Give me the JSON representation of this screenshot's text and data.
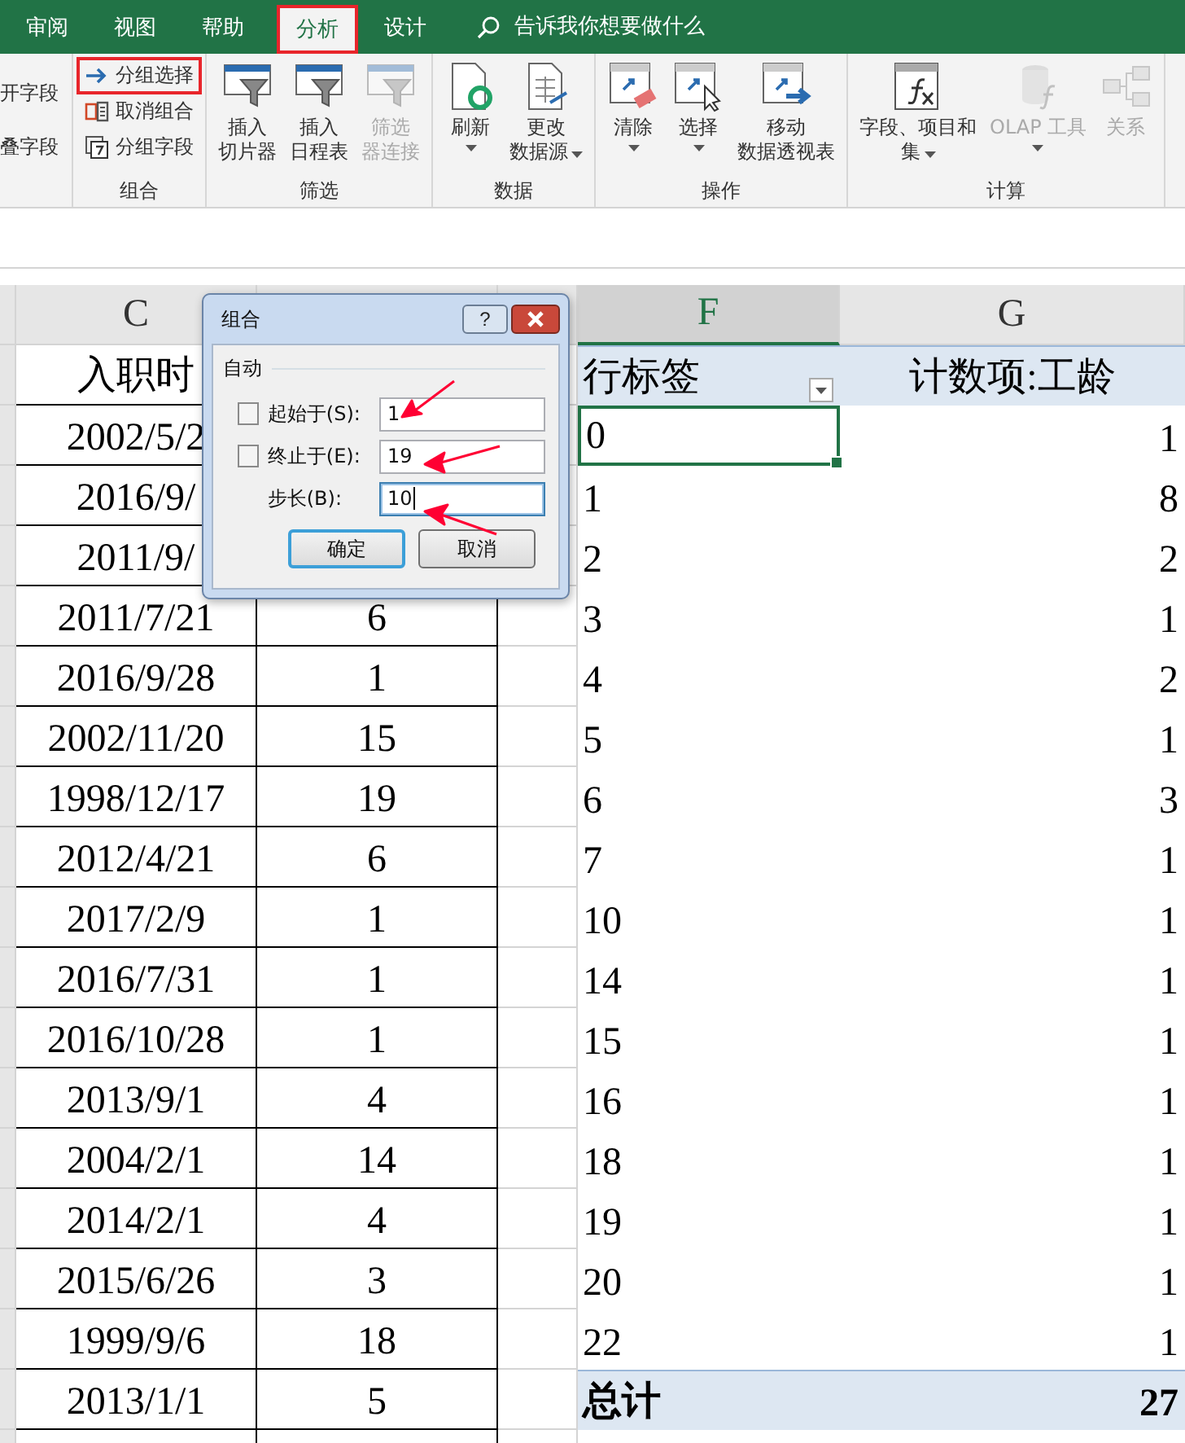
{
  "ribbon_tabs": [
    {
      "label": "审阅",
      "selected": false,
      "highlighted": false
    },
    {
      "label": "视图",
      "selected": false,
      "highlighted": false
    },
    {
      "label": "帮助",
      "selected": false,
      "highlighted": false
    },
    {
      "label": "分析",
      "selected": true,
      "highlighted": true
    },
    {
      "label": "设计",
      "selected": false,
      "highlighted": false
    }
  ],
  "tell_me": {
    "placeholder": "告诉我你想要做什么"
  },
  "partial_group": {
    "items": [
      "开字段",
      "叠字段"
    ]
  },
  "ribbon_groups": [
    {
      "label": "组合",
      "kind": "small",
      "items": [
        {
          "lines": [
            "分组选择"
          ],
          "highlighted": true,
          "disabled": false
        },
        {
          "lines": [
            "取消组合"
          ],
          "highlighted": false,
          "disabled": false
        },
        {
          "lines": [
            "分组字段"
          ],
          "highlighted": false,
          "disabled": false
        }
      ]
    },
    {
      "label": "筛选",
      "kind": "large",
      "items": [
        {
          "lines": [
            "插入",
            "切片器"
          ],
          "highlighted": false,
          "disabled": false,
          "dropdown": false
        },
        {
          "lines": [
            "插入",
            "日程表"
          ],
          "highlighted": false,
          "disabled": false,
          "dropdown": false
        },
        {
          "lines": [
            "筛选",
            "器连接"
          ],
          "highlighted": false,
          "disabled": true,
          "dropdown": false
        }
      ]
    },
    {
      "label": "数据",
      "kind": "large",
      "items": [
        {
          "lines": [
            "刷新"
          ],
          "highlighted": false,
          "disabled": false,
          "dropdown": true
        },
        {
          "lines": [
            "更改",
            "数据源"
          ],
          "highlighted": false,
          "disabled": false,
          "dropdown": true
        }
      ]
    },
    {
      "label": "操作",
      "kind": "large",
      "items": [
        {
          "lines": [
            "清除"
          ],
          "highlighted": false,
          "disabled": false,
          "dropdown": true
        },
        {
          "lines": [
            "选择"
          ],
          "highlighted": false,
          "disabled": false,
          "dropdown": true
        },
        {
          "lines": [
            "移动",
            "数据透视表"
          ],
          "highlighted": false,
          "disabled": false,
          "dropdown": false
        }
      ]
    },
    {
      "label": "计算",
      "kind": "large",
      "items": [
        {
          "lines": [
            "字段、项目和",
            "集"
          ],
          "highlighted": false,
          "disabled": false,
          "dropdown": true
        },
        {
          "lines": [
            "OLAP 工具"
          ],
          "highlighted": false,
          "disabled": true,
          "dropdown": true
        },
        {
          "lines": [
            "关系"
          ],
          "highlighted": false,
          "disabled": true,
          "dropdown": false
        }
      ]
    }
  ],
  "column_headers": [
    {
      "label": "C",
      "selected": false
    },
    {
      "label": "F",
      "selected": true
    },
    {
      "label": "G",
      "selected": false
    }
  ],
  "data_table": {
    "header": "入职时",
    "rows": [
      {
        "date": "2002/5/2"
      },
      {
        "date": "2016/9/"
      },
      {
        "date": "2011/9/"
      },
      {
        "date": "2011/7/21",
        "years": "6"
      },
      {
        "date": "2016/9/28",
        "years": "1"
      },
      {
        "date": "2002/11/20",
        "years": "15"
      },
      {
        "date": "1998/12/17",
        "years": "19"
      },
      {
        "date": "2012/4/21",
        "years": "6"
      },
      {
        "date": "2017/2/9",
        "years": "1"
      },
      {
        "date": "2016/7/31",
        "years": "1"
      },
      {
        "date": "2016/10/28",
        "years": "1"
      },
      {
        "date": "2013/9/1",
        "years": "4"
      },
      {
        "date": "2004/2/1",
        "years": "14"
      },
      {
        "date": "2014/2/1",
        "years": "4"
      },
      {
        "date": "2015/6/26",
        "years": "3"
      },
      {
        "date": "1999/9/6",
        "years": "18"
      },
      {
        "date": "2013/1/1",
        "years": "5"
      }
    ]
  },
  "pivot": {
    "row_header": "行标签",
    "value_header": "计数项:工龄",
    "rows": [
      {
        "label": "0",
        "count": "1",
        "selected": true
      },
      {
        "label": "1",
        "count": "8",
        "selected": false
      },
      {
        "label": "2",
        "count": "2",
        "selected": false
      },
      {
        "label": "3",
        "count": "1",
        "selected": false
      },
      {
        "label": "4",
        "count": "2",
        "selected": false
      },
      {
        "label": "5",
        "count": "1",
        "selected": false
      },
      {
        "label": "6",
        "count": "3",
        "selected": false
      },
      {
        "label": "7",
        "count": "1",
        "selected": false
      },
      {
        "label": "10",
        "count": "1",
        "selected": false
      },
      {
        "label": "14",
        "count": "1",
        "selected": false
      },
      {
        "label": "15",
        "count": "1",
        "selected": false
      },
      {
        "label": "16",
        "count": "1",
        "selected": false
      },
      {
        "label": "18",
        "count": "1",
        "selected": false
      },
      {
        "label": "19",
        "count": "1",
        "selected": false
      },
      {
        "label": "20",
        "count": "1",
        "selected": false
      },
      {
        "label": "22",
        "count": "1",
        "selected": false
      }
    ],
    "total_label": "总计",
    "total": "27"
  },
  "dialog": {
    "title": "组合",
    "help_button": "?",
    "group_label": "自动",
    "fields": [
      {
        "kind": "checkbox",
        "label": "起始于(S):",
        "checked": false,
        "value": "1",
        "focused": false,
        "annotated": true
      },
      {
        "kind": "checkbox",
        "label": "终止于(E):",
        "checked": false,
        "value": "19",
        "focused": false,
        "annotated": true
      },
      {
        "kind": "plain",
        "label": "步长(B):",
        "value": "10",
        "focused": true,
        "annotated": true
      }
    ],
    "buttons": [
      {
        "label": "确定",
        "default": true
      },
      {
        "label": "取消",
        "default": false
      }
    ]
  }
}
